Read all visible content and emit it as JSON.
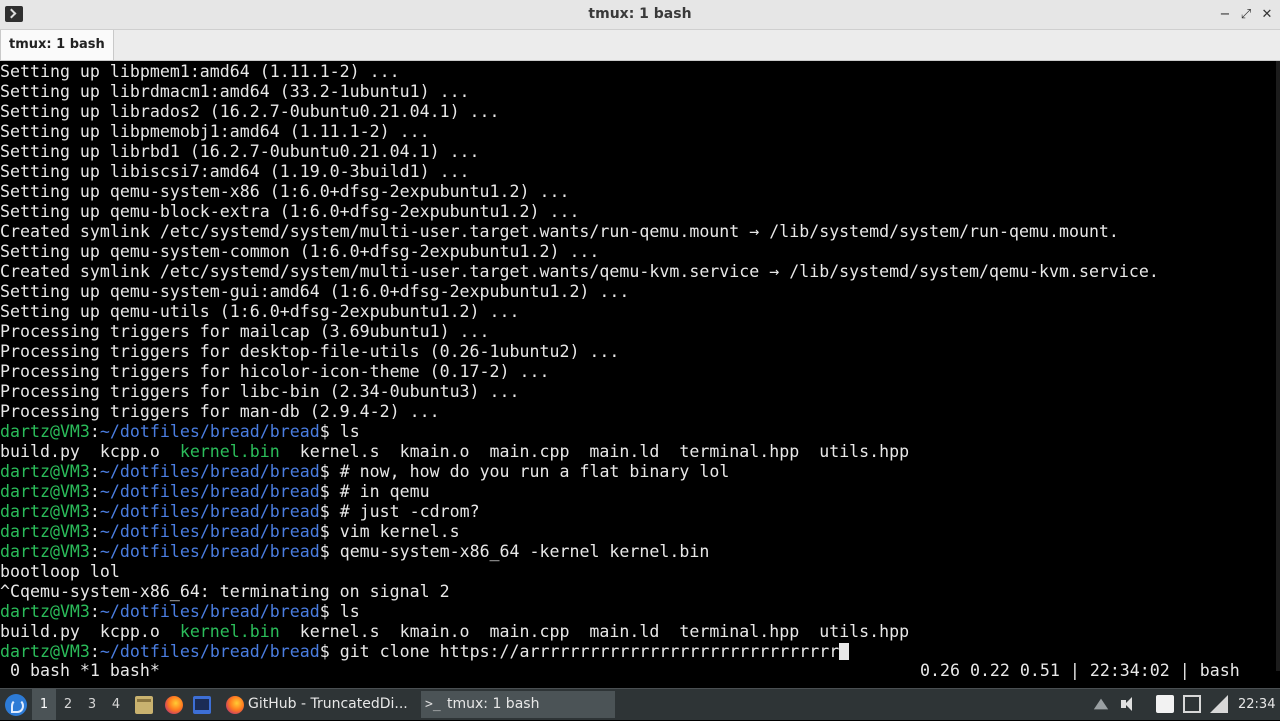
{
  "window": {
    "title": "tmux: 1 bash",
    "minimize": "−",
    "maximize": "⤢",
    "close": "✕"
  },
  "tabs": [
    {
      "label": "tmux: 1 bash"
    }
  ],
  "terminal": {
    "lines": [
      [
        {
          "t": "Setting up libpmem1:amd64 (1.11.1-2) ..."
        }
      ],
      [
        {
          "t": "Setting up librdmacm1:amd64 (33.2-1ubuntu1) ..."
        }
      ],
      [
        {
          "t": "Setting up librados2 (16.2.7-0ubuntu0.21.04.1) ..."
        }
      ],
      [
        {
          "t": "Setting up libpmemobj1:amd64 (1.11.1-2) ..."
        }
      ],
      [
        {
          "t": "Setting up librbd1 (16.2.7-0ubuntu0.21.04.1) ..."
        }
      ],
      [
        {
          "t": "Setting up libiscsi7:amd64 (1.19.0-3build1) ..."
        }
      ],
      [
        {
          "t": "Setting up qemu-system-x86 (1:6.0+dfsg-2expubuntu1.2) ..."
        }
      ],
      [
        {
          "t": "Setting up qemu-block-extra (1:6.0+dfsg-2expubuntu1.2) ..."
        }
      ],
      [
        {
          "t": "Created symlink /etc/systemd/system/multi-user.target.wants/run-qemu.mount → /lib/systemd/system/run-qemu.mount."
        }
      ],
      [
        {
          "t": "Setting up qemu-system-common (1:6.0+dfsg-2expubuntu1.2) ..."
        }
      ],
      [
        {
          "t": "Created symlink /etc/systemd/system/multi-user.target.wants/qemu-kvm.service → /lib/systemd/system/qemu-kvm.service."
        }
      ],
      [
        {
          "t": "Setting up qemu-system-gui:amd64 (1:6.0+dfsg-2expubuntu1.2) ..."
        }
      ],
      [
        {
          "t": "Setting up qemu-utils (1:6.0+dfsg-2expubuntu1.2) ..."
        }
      ],
      [
        {
          "t": "Processing triggers for mailcap (3.69ubuntu1) ..."
        }
      ],
      [
        {
          "t": "Processing triggers for desktop-file-utils (0.26-1ubuntu2) ..."
        }
      ],
      [
        {
          "t": "Processing triggers for hicolor-icon-theme (0.17-2) ..."
        }
      ],
      [
        {
          "t": "Processing triggers for libc-bin (2.34-0ubuntu3) ..."
        }
      ],
      [
        {
          "t": "Processing triggers for man-db (2.9.4-2) ..."
        }
      ],
      [
        {
          "t": "dartz@VM3",
          "c": "user"
        },
        {
          "t": ":"
        },
        {
          "t": "~/dotfiles/bread/bread",
          "c": "path"
        },
        {
          "t": "$ ls"
        }
      ],
      [
        {
          "t": "build.py  kcpp.o  "
        },
        {
          "t": "kernel.bin",
          "c": "green"
        },
        {
          "t": "  kernel.s  kmain.o  main.cpp  main.ld  terminal.hpp  utils.hpp"
        }
      ],
      [
        {
          "t": "dartz@VM3",
          "c": "user"
        },
        {
          "t": ":"
        },
        {
          "t": "~/dotfiles/bread/bread",
          "c": "path"
        },
        {
          "t": "$ # now, how do you run a flat binary lol"
        }
      ],
      [
        {
          "t": "dartz@VM3",
          "c": "user"
        },
        {
          "t": ":"
        },
        {
          "t": "~/dotfiles/bread/bread",
          "c": "path"
        },
        {
          "t": "$ # in qemu"
        }
      ],
      [
        {
          "t": "dartz@VM3",
          "c": "user"
        },
        {
          "t": ":"
        },
        {
          "t": "~/dotfiles/bread/bread",
          "c": "path"
        },
        {
          "t": "$ # just -cdrom?"
        }
      ],
      [
        {
          "t": "dartz@VM3",
          "c": "user"
        },
        {
          "t": ":"
        },
        {
          "t": "~/dotfiles/bread/bread",
          "c": "path"
        },
        {
          "t": "$ vim kernel.s"
        }
      ],
      [
        {
          "t": "dartz@VM3",
          "c": "user"
        },
        {
          "t": ":"
        },
        {
          "t": "~/dotfiles/bread/bread",
          "c": "path"
        },
        {
          "t": "$ qemu-system-x86_64 -kernel kernel.bin"
        }
      ],
      [
        {
          "t": "bootloop lol"
        }
      ],
      [
        {
          "t": "^Cqemu-system-x86_64: terminating on signal 2"
        }
      ],
      [
        {
          "t": "dartz@VM3",
          "c": "user"
        },
        {
          "t": ":"
        },
        {
          "t": "~/dotfiles/bread/bread",
          "c": "path"
        },
        {
          "t": "$ ls"
        }
      ],
      [
        {
          "t": "build.py  kcpp.o  "
        },
        {
          "t": "kernel.bin",
          "c": "green"
        },
        {
          "t": "  kernel.s  kmain.o  main.cpp  main.ld  terminal.hpp  utils.hpp"
        }
      ],
      [
        {
          "t": "dartz@VM3",
          "c": "user"
        },
        {
          "t": ":"
        },
        {
          "t": "~/dotfiles/bread/bread",
          "c": "path"
        },
        {
          "t": "$ git clone https://arrrrrrrrrrrrrrrrrrrrrrrrrrrrrrr"
        },
        {
          "t": "",
          "c": "cursor"
        }
      ]
    ]
  },
  "tmux": {
    "left": " 0 bash *1 bash*",
    "right": "0.26 0.22 0.51 | 22:34:02 | bash"
  },
  "taskbar": {
    "workspaces": [
      "1",
      "2",
      "3",
      "4"
    ],
    "active_workspace": "1",
    "tasks": [
      {
        "label": "GitHub - TruncatedDi..."
      },
      {
        "label": "tmux: 1 bash",
        "glyph": ">_"
      }
    ],
    "clock": "22:34"
  },
  "colors": {
    "prompt_user": "#2bbd5a",
    "prompt_path": "#4a7de0",
    "executable": "#2bbd5a",
    "terminal_bg": "#000000",
    "terminal_fg": "#e8e8e8"
  }
}
